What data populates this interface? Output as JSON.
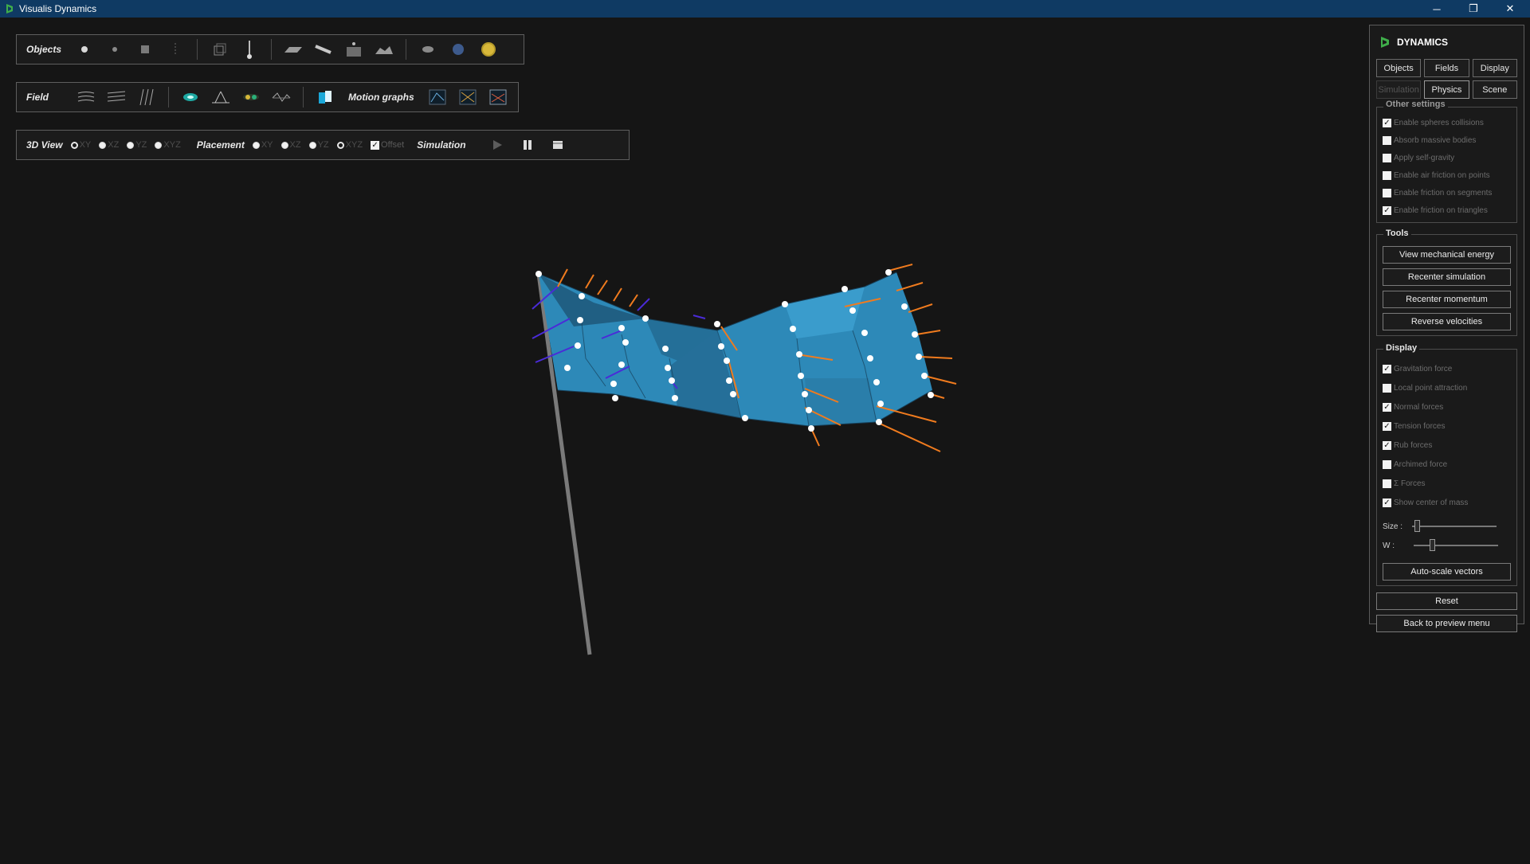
{
  "window": {
    "title": "Visualis Dynamics",
    "minimize": "─",
    "restore": "❐",
    "close": "✕"
  },
  "toolbar1": {
    "label": "Objects"
  },
  "toolbar2": {
    "label": "Field",
    "motion_label": "Motion graphs"
  },
  "toolbar3": {
    "view_label": "3D View",
    "view_options": [
      "XY",
      "XZ",
      "YZ",
      "XYZ"
    ],
    "view_selected": "XY",
    "placement_label": "Placement",
    "placement_options": [
      "XY",
      "XZ",
      "YZ",
      "XYZ"
    ],
    "placement_selected": "XYZ",
    "offset_label": "Offset",
    "offset_checked": true,
    "simulation_label": "Simulation"
  },
  "panel": {
    "title": "DYNAMICS",
    "tabs_row1": [
      "Objects",
      "Fields",
      "Display"
    ],
    "tabs_row2": [
      "Simulation",
      "Physics",
      "Scene"
    ],
    "other_settings": {
      "title": "Other settings",
      "items": [
        {
          "label": "Enable spheres collisions",
          "checked": true
        },
        {
          "label": "Absorb massive bodies",
          "checked": false
        },
        {
          "label": "Apply self-gravity",
          "checked": false
        },
        {
          "label": "Enable air friction on points",
          "checked": false
        },
        {
          "label": "Enable friction on segments",
          "checked": false
        },
        {
          "label": "Enable friction on triangles",
          "checked": true
        }
      ]
    },
    "tools": {
      "title": "Tools",
      "buttons": [
        "View mechanical energy",
        "Recenter simulation",
        "Recenter momentum",
        "Reverse velocities"
      ]
    },
    "display": {
      "title": "Display",
      "items": [
        {
          "label": "Gravitation force",
          "checked": true
        },
        {
          "label": "Local point attraction",
          "checked": false
        },
        {
          "label": "Normal forces",
          "checked": true
        },
        {
          "label": "Tension forces",
          "checked": true
        },
        {
          "label": "Rub forces",
          "checked": true
        },
        {
          "label": "Archimed force",
          "checked": false
        },
        {
          "label": "Σ Forces",
          "checked": false
        },
        {
          "label": "Show center of mass",
          "checked": true
        }
      ],
      "size_label": "Size :",
      "w_label": "W :",
      "size_value": 0.03,
      "w_value": 0.2,
      "autoscale": "Auto-scale vectors"
    },
    "reset": "Reset",
    "back": "Back to preview menu"
  },
  "colors": {
    "flag": "#2d89b8",
    "arrow_tension": "#f07b1e",
    "arrow_normal": "#4a2bd8",
    "titlebar": "#0f3a63"
  }
}
